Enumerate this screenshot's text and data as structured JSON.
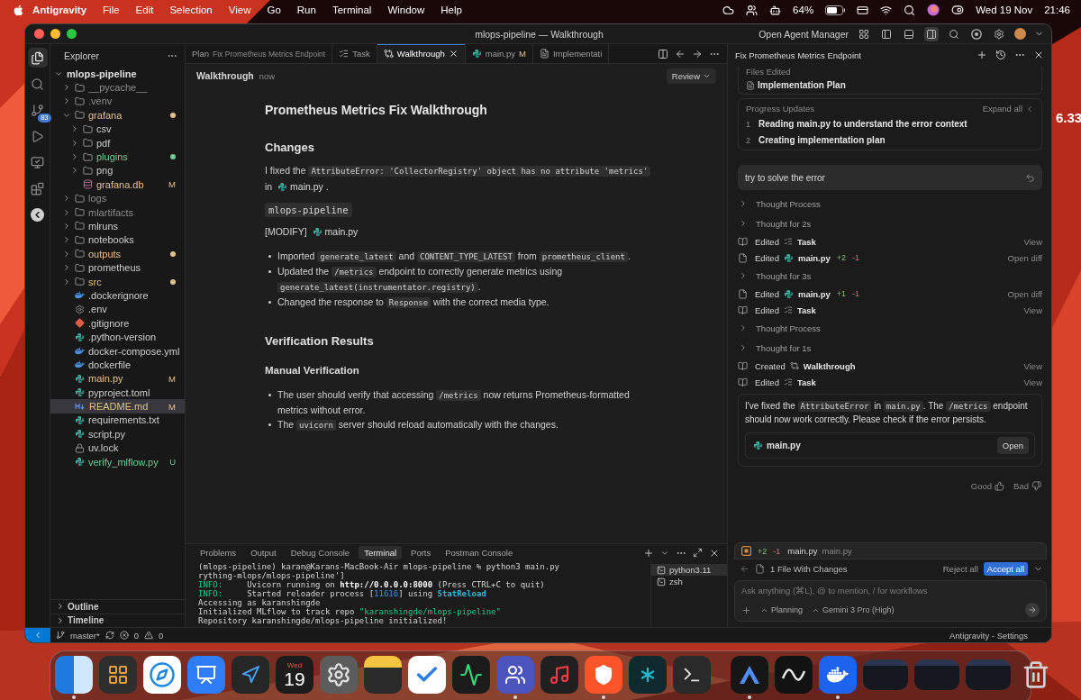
{
  "menu_bar": {
    "app": "Antigravity",
    "menus": [
      "File",
      "Edit",
      "Selection",
      "View",
      "Go",
      "Run",
      "Terminal",
      "Window",
      "Help"
    ],
    "battery_percent": "64%",
    "date": "Wed 19 Nov",
    "time": "21:46"
  },
  "desktop_widget_text": "6.33",
  "window": {
    "title": "mlops-pipeline — Walkthrough",
    "agent_manager_button": "Open Agent Manager"
  },
  "activity_bar": [
    {
      "kind": "explorer",
      "selected": true
    },
    {
      "kind": "search",
      "selected": false
    },
    {
      "kind": "source-control",
      "selected": false,
      "badge": "83"
    },
    {
      "kind": "run",
      "selected": false
    },
    {
      "kind": "remote",
      "selected": false
    },
    {
      "kind": "extensions",
      "selected": false
    },
    {
      "kind": "agent",
      "selected": false
    }
  ],
  "explorer": {
    "title": "Explorer",
    "root": {
      "name": "mlops-pipeline",
      "expanded": true,
      "children": [
        {
          "name": "__pycache__",
          "kind": "folder",
          "expanded": false,
          "color": "#8c8c8c",
          "dot": false,
          "selected": false
        },
        {
          "name": ".venv",
          "kind": "folder",
          "expanded": false,
          "color": "#8c8c8c",
          "dot": false,
          "selected": false
        },
        {
          "name": "grafana",
          "kind": "folder",
          "expanded": true,
          "color": "#e2c08d",
          "dot": true,
          "selected": false,
          "children": [
            {
              "name": "csv",
              "kind": "folder",
              "expanded": false,
              "dot": false,
              "selected": false
            },
            {
              "name": "pdf",
              "kind": "folder",
              "expanded": false,
              "dot": false,
              "selected": false
            },
            {
              "name": "plugins",
              "kind": "folder",
              "expanded": false,
              "color": "#73c991",
              "dot": true,
              "selected": false
            },
            {
              "name": "png",
              "kind": "folder",
              "expanded": false,
              "dot": false,
              "selected": false
            },
            {
              "name": "grafana.db",
              "kind": "database",
              "color": "#e2c08d",
              "badge": "M",
              "selected": false
            }
          ]
        },
        {
          "name": "logs",
          "kind": "folder",
          "expanded": false,
          "color": "#8c8c8c",
          "dot": false,
          "selected": false
        },
        {
          "name": "mlartifacts",
          "kind": "folder",
          "expanded": false,
          "color": "#8c8c8c",
          "dot": false,
          "selected": false
        },
        {
          "name": "mlruns",
          "kind": "folder",
          "expanded": false,
          "dot": false,
          "selected": false
        },
        {
          "name": "notebooks",
          "kind": "folder",
          "expanded": false,
          "dot": false,
          "selected": false
        },
        {
          "name": "outputs",
          "kind": "folder",
          "expanded": false,
          "color": "#e2c08d",
          "dot": true,
          "selected": false
        },
        {
          "name": "prometheus",
          "kind": "folder",
          "expanded": false,
          "dot": false,
          "selected": false
        },
        {
          "name": "src",
          "kind": "folder",
          "expanded": false,
          "color": "#e2c08d",
          "dot": true,
          "selected": false
        },
        {
          "name": ".dockerignore",
          "kind": "docker",
          "selected": false
        },
        {
          "name": ".env",
          "kind": "gear",
          "selected": false
        },
        {
          "name": ".gitignore",
          "kind": "git",
          "selected": false
        },
        {
          "name": ".python-version",
          "kind": "python",
          "selected": false
        },
        {
          "name": "docker-compose.yml",
          "kind": "docker",
          "selected": false
        },
        {
          "name": "dockerfile",
          "kind": "docker",
          "selected": false
        },
        {
          "name": "main.py",
          "kind": "python",
          "color": "#e2c08d",
          "badge": "M",
          "selected": false
        },
        {
          "name": "pyproject.toml",
          "kind": "python",
          "selected": false
        },
        {
          "name": "README.md",
          "kind": "markdown",
          "color": "#e2c08d",
          "badge": "M",
          "selected": true
        },
        {
          "name": "requirements.txt",
          "kind": "python",
          "selected": false
        },
        {
          "name": "script.py",
          "kind": "python",
          "selected": false
        },
        {
          "name": "uv.lock",
          "kind": "lock",
          "selected": false
        },
        {
          "name": "verify_mlflow.py",
          "kind": "python",
          "color": "#73c991",
          "badge": "U",
          "selected": false
        }
      ]
    },
    "sections": [
      {
        "label": "Outline",
        "expanded": false
      },
      {
        "label": "Timeline",
        "expanded": false
      }
    ]
  },
  "editor_tabs": [
    {
      "label": "Plan",
      "description": "Fix Prometheus Metrics Endpoint",
      "selected": false
    },
    {
      "label": "Task",
      "kind": "task",
      "selected": false
    },
    {
      "label": "Walkthrough",
      "kind": "walkthrough",
      "selected": true
    },
    {
      "label": "main.py",
      "kind": "python",
      "badge": "M",
      "selected": false
    },
    {
      "label": "Implementati",
      "kind": "document",
      "selected": false
    }
  ],
  "editor_header": {
    "title": "Walkthrough",
    "time": "now",
    "review_button": "Review"
  },
  "document": [
    {
      "kind": "h1",
      "text": "Prometheus Metrics Fix Walkthrough"
    },
    {
      "kind": "h2",
      "text": "Changes"
    },
    {
      "kind": "p",
      "segments": [
        {
          "kind": "text",
          "text": "I fixed the "
        },
        {
          "kind": "code",
          "text": "AttributeError: 'CollectorRegistry' object has no attribute 'metrics'"
        },
        {
          "kind": "text",
          "text": " in "
        },
        {
          "kind": "file",
          "text": "main.py"
        },
        {
          "kind": "text",
          "text": " ."
        }
      ]
    },
    {
      "kind": "code_block",
      "text": "mlops-pipeline"
    },
    {
      "kind": "p",
      "segments": [
        {
          "kind": "text",
          "text": "[MODIFY] "
        },
        {
          "kind": "file",
          "text": "main.py"
        }
      ]
    },
    {
      "kind": "ul",
      "items": [
        [
          {
            "kind": "text",
            "text": "Imported "
          },
          {
            "kind": "code",
            "text": "generate_latest"
          },
          {
            "kind": "text",
            "text": " and "
          },
          {
            "kind": "code",
            "text": "CONTENT_TYPE_LATEST"
          },
          {
            "kind": "text",
            "text": " from "
          },
          {
            "kind": "code",
            "text": "prometheus_client"
          },
          {
            "kind": "text",
            "text": "."
          }
        ],
        [
          {
            "kind": "text",
            "text": "Updated the "
          },
          {
            "kind": "code",
            "text": "/metrics"
          },
          {
            "kind": "text",
            "text": " endpoint to correctly generate metrics using "
          },
          {
            "kind": "code",
            "text": "generate_latest(instrumentator.registry)"
          },
          {
            "kind": "text",
            "text": "."
          }
        ],
        [
          {
            "kind": "text",
            "text": "Changed the response to "
          },
          {
            "kind": "code",
            "text": "Response"
          },
          {
            "kind": "text",
            "text": " with the correct media type."
          }
        ]
      ]
    },
    {
      "kind": "h2",
      "text": "Verification Results"
    },
    {
      "kind": "h3",
      "text": "Manual Verification"
    },
    {
      "kind": "ul",
      "items": [
        [
          {
            "kind": "text",
            "text": "The user should verify that accessing "
          },
          {
            "kind": "code",
            "text": "/metrics"
          },
          {
            "kind": "text",
            "text": " now returns Prometheus-formatted metrics without error."
          }
        ],
        [
          {
            "kind": "text",
            "text": "The "
          },
          {
            "kind": "code",
            "text": "uvicorn"
          },
          {
            "kind": "text",
            "text": " server should reload automatically with the changes."
          }
        ]
      ]
    }
  ],
  "panel": {
    "tabs": [
      {
        "label": "Problems",
        "selected": false
      },
      {
        "label": "Output",
        "selected": false
      },
      {
        "label": "Debug Console",
        "selected": false
      },
      {
        "label": "Terminal",
        "selected": true
      },
      {
        "label": "Ports",
        "selected": false
      },
      {
        "label": "Postman Console",
        "selected": false
      }
    ],
    "lines": [
      [
        {
          "kind": "plain",
          "text": "(mlops-pipeline) karan@Karans-MacBook-Air mlops-pipeline % python3 main.py"
        }
      ],
      [
        {
          "kind": "plain",
          "text": "rything-mlops/mlops-pipeline']"
        }
      ],
      [
        {
          "kind": "info",
          "text": "INFO:     "
        },
        {
          "kind": "plain",
          "text": "Uvicorn running on "
        },
        {
          "kind": "bold",
          "text": "http://0.0.0.0:8000"
        },
        {
          "kind": "plain",
          "text": " (Press CTRL+C to quit)"
        }
      ],
      [
        {
          "kind": "info",
          "text": "INFO:     "
        },
        {
          "kind": "plain",
          "text": "Started reloader process ["
        },
        {
          "kind": "number",
          "text": "11616"
        },
        {
          "kind": "plain",
          "text": "] using "
        },
        {
          "kind": "accent",
          "text": "StatReload"
        }
      ],
      [
        {
          "kind": "plain",
          "text": "Accessing as karanshingde"
        }
      ],
      [
        {
          "kind": "plain",
          "text": "Initialized MLflow to track repo "
        },
        {
          "kind": "string",
          "text": "\"karanshingde/mlops-pipeline\""
        }
      ],
      [
        {
          "kind": "plain",
          "text": "Repository karanshingde/mlops-pipeline initialized!"
        }
      ]
    ],
    "terminals": [
      {
        "label": "python3.11",
        "selected": true
      },
      {
        "label": "zsh",
        "selected": false
      }
    ]
  },
  "agent_panel": {
    "title": "Fix Prometheus Metrics Endpoint",
    "files_edited": {
      "label": "Files Edited",
      "items": [
        "Implementation Plan"
      ]
    },
    "progress": {
      "label": "Progress Updates",
      "expand_label": "Expand all",
      "steps": [
        {
          "number": "1",
          "text": "Reading main.py to understand the error context"
        },
        {
          "number": "2",
          "text": "Creating implementation plan"
        }
      ]
    },
    "user_message": "try to solve the error",
    "timeline": [
      {
        "kind": "thought",
        "text": "Thought Process"
      },
      {
        "kind": "thought",
        "text": "Thought for 2s"
      },
      {
        "kind": "action",
        "verb": "Edited",
        "artifact": {
          "kind": "task",
          "name": "Task"
        },
        "link": "View"
      },
      {
        "kind": "action",
        "verb": "Edited",
        "artifact": {
          "kind": "python",
          "name": "main.py"
        },
        "added": "+2",
        "removed": "-1",
        "link": "Open diff"
      },
      {
        "kind": "thought",
        "text": "Thought for 3s"
      },
      {
        "kind": "action",
        "verb": "Edited",
        "artifact": {
          "kind": "python",
          "name": "main.py"
        },
        "added": "+1",
        "removed": "-1",
        "link": "Open diff"
      },
      {
        "kind": "action",
        "verb": "Edited",
        "artifact": {
          "kind": "task",
          "name": "Task"
        },
        "link": "View"
      },
      {
        "kind": "thought",
        "text": "Thought Process"
      },
      {
        "kind": "thought",
        "text": "Thought for 1s"
      },
      {
        "kind": "action",
        "verb": "Created",
        "artifact": {
          "kind": "walkthrough",
          "name": "Walkthrough"
        },
        "link": "View"
      },
      {
        "kind": "action",
        "verb": "Edited",
        "artifact": {
          "kind": "task",
          "name": "Task"
        },
        "link": "View"
      }
    ],
    "reply": {
      "segments": [
        {
          "kind": "text",
          "text": "I've fixed the "
        },
        {
          "kind": "code",
          "text": "AttributeError"
        },
        {
          "kind": "text",
          "text": " in "
        },
        {
          "kind": "code",
          "text": "main.py"
        },
        {
          "kind": "text",
          "text": ". The "
        },
        {
          "kind": "code",
          "text": "/metrics"
        },
        {
          "kind": "text",
          "text": " endpoint should now work correctly. Please check if the error persists."
        }
      ],
      "file": "main.py",
      "open_button": "Open"
    },
    "feedback": [
      {
        "kind": "good",
        "label": "Good"
      },
      {
        "kind": "bad",
        "label": "Bad"
      }
    ],
    "changes": {
      "added": "+2",
      "removed": "-1",
      "file": "main.py",
      "path": "main.py",
      "summary": "1 File With Changes",
      "reject": "Reject all",
      "accept": "Accept all"
    },
    "input": {
      "placeholder": "Ask anything (⌘L), @ to mention, / for workflows",
      "mode": "Planning",
      "model": "Gemini 3 Pro (High)"
    }
  },
  "status_bar": {
    "branch": "master*",
    "errors": "0",
    "warnings": "0",
    "right": "Antigravity - Settings"
  },
  "dock": [
    {
      "kind": "finder",
      "running": true
    },
    {
      "kind": "launchpad",
      "running": false
    },
    {
      "kind": "safari",
      "running": false
    },
    {
      "kind": "keynote",
      "running": false
    },
    {
      "kind": "navigator",
      "running": false
    },
    {
      "kind": "calendar",
      "weekday": "Wed",
      "day": "19",
      "running": false
    },
    {
      "kind": "settings",
      "running": false
    },
    {
      "kind": "notes",
      "running": false
    },
    {
      "kind": "tasks",
      "running": false
    },
    {
      "kind": "activity",
      "running": false
    },
    {
      "kind": "teams",
      "running": true
    },
    {
      "kind": "music",
      "running": false
    },
    {
      "kind": "brave",
      "running": true
    },
    {
      "kind": "perplexity",
      "running": false
    },
    {
      "kind": "terminal",
      "running": false
    },
    {
      "kind": "separator"
    },
    {
      "kind": "antigravity",
      "running": true
    },
    {
      "kind": "waves",
      "running": false
    },
    {
      "kind": "docker",
      "running": true
    },
    {
      "kind": "thumbnail",
      "running": false
    },
    {
      "kind": "thumbnail",
      "running": false
    },
    {
      "kind": "thumbnail",
      "running": false
    },
    {
      "kind": "trash",
      "running": false
    }
  ]
}
